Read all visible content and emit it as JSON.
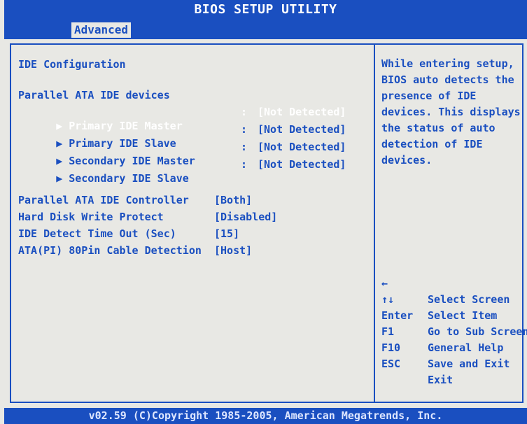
{
  "header": {
    "title": "BIOS SETUP UTILITY",
    "active_tab": "Advanced"
  },
  "main": {
    "section_title": "IDE Configuration",
    "group_title": "Parallel ATA IDE devices",
    "devices": [
      {
        "label": "Primary IDE Master",
        "separator": ":",
        "value": "[Not Detected]"
      },
      {
        "label": "Primary IDE Slave",
        "separator": ":",
        "value": "[Not Detected]"
      },
      {
        "label": "Secondary IDE Master",
        "separator": ":",
        "value": "[Not Detected]"
      },
      {
        "label": "Secondary IDE Slave",
        "separator": ":",
        "value": "[Not Detected]"
      }
    ],
    "settings": [
      {
        "label": "Parallel ATA IDE Controller",
        "value": "[Both]"
      },
      {
        "label": "Hard Disk Write Protect",
        "value": "[Disabled]"
      },
      {
        "label": "IDE Detect Time Out (Sec)",
        "value": "[15]"
      },
      {
        "label": "ATA(PI) 80Pin Cable Detection",
        "value": "[Host]"
      }
    ],
    "arrow_glyph": "▶"
  },
  "help_panel": {
    "lines": [
      "While entering setup,",
      "BIOS auto detects the",
      "presence of IDE",
      "devices. This displays",
      "the status of auto",
      "detection of IDE",
      "devices."
    ],
    "legend": [
      {
        "key": "←",
        "action": "Select Screen"
      },
      {
        "key": "↑↓",
        "action": "Select Item"
      },
      {
        "key": "Enter",
        "action": "Go to Sub Screen"
      },
      {
        "key": "F1",
        "action": "General Help"
      },
      {
        "key": "F10",
        "action": "Save and Exit"
      },
      {
        "key": "ESC",
        "action": "Exit"
      }
    ]
  },
  "footer": {
    "copyright": "v02.59 (C)Copyright 1985-2005, American Megatrends, Inc."
  },
  "colors": {
    "bios_blue": "#1a4fc0",
    "panel_background": "#e8e8e4",
    "highlight_white": "#ffffff"
  }
}
